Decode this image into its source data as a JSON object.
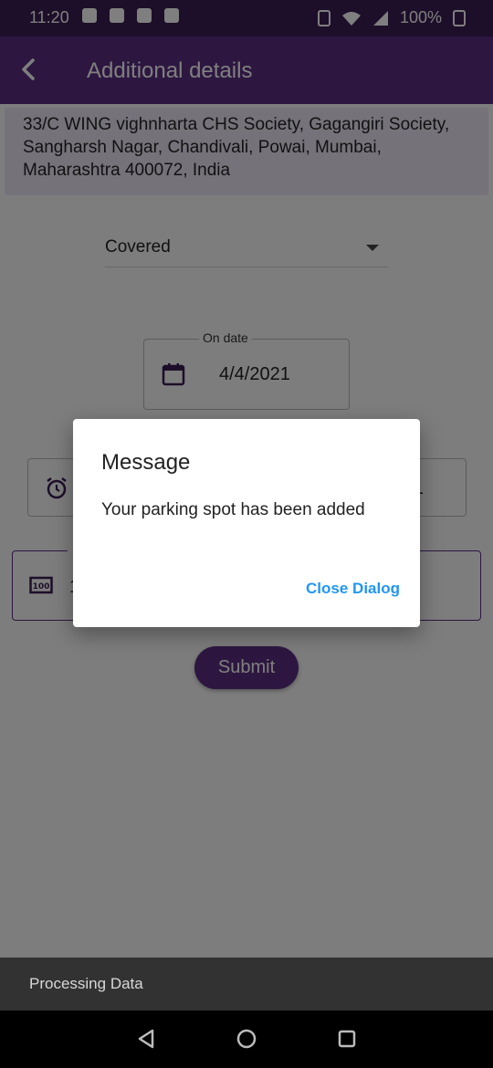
{
  "status_bar": {
    "time": "11:20",
    "battery": "100%"
  },
  "app_bar": {
    "title": "Additional details",
    "back_icon": "back-arrow-icon"
  },
  "form": {
    "address": "33/C WING vighnharta CHS Society, Gagangiri Society, Sangharsh Nagar, Chandivali, Powai, Mumbai, Maharashtra 400072, India",
    "parking_type": "Covered",
    "date_label": "On date",
    "date_value": "4/4/2021",
    "time_value_tail": "1",
    "slots_value_stub": "1",
    "submit_label": "Submit"
  },
  "dialog": {
    "title": "Message",
    "body": "Your parking spot has been added",
    "action": "Close Dialog"
  },
  "snackbar": {
    "text": "Processing Data"
  },
  "colors": {
    "primary": "#5b2f83",
    "status_bar": "#3a1d52",
    "accent": "#2196f3",
    "address_bg": "#ede4f5"
  }
}
